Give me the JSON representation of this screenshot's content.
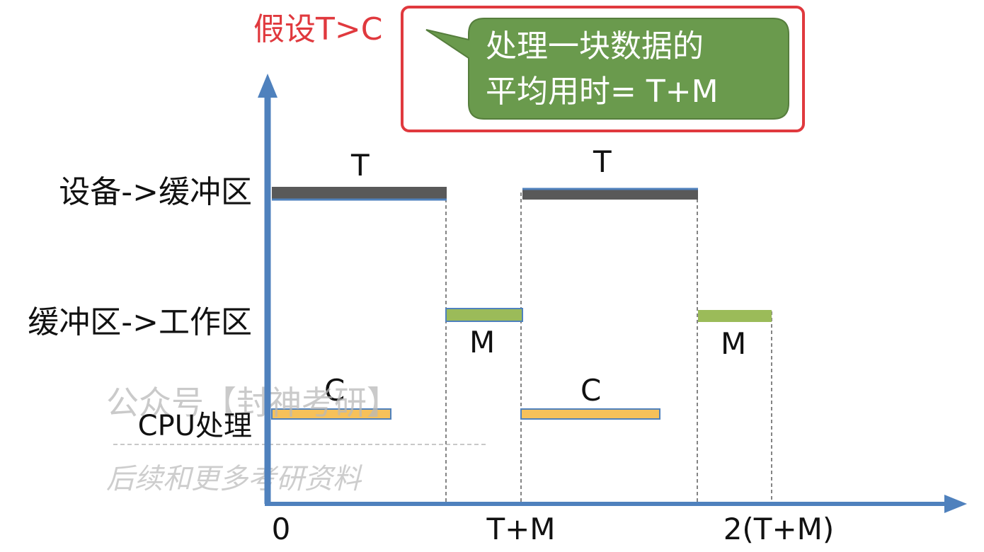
{
  "assumption": "假设T>C",
  "callout": {
    "line1": "处理一块数据的",
    "line2": "平均用时= T+M"
  },
  "rows": {
    "device_to_buffer": "设备->缓冲区",
    "buffer_to_work": "缓冲区->工作区",
    "cpu": "CPU处理"
  },
  "bar_labels": {
    "t1": "T",
    "t2": "T",
    "m1": "M",
    "m2": "M",
    "c1": "C",
    "c2": "C"
  },
  "x_ticks": {
    "zero": "0",
    "one": "T+M",
    "two": "2(T+M)"
  },
  "watermark": {
    "line1": "公众号【封神考研】",
    "line2": "后续和更多考研资料"
  },
  "colors": {
    "axis": "#4f81bd",
    "device_bar": "#595959",
    "buffer_bar": "#9bbb59",
    "cpu_bar": "#f6c15a",
    "callout": "#6a9a4d",
    "highlight": "#e0393e",
    "assumption_text": "#e0393e"
  }
}
